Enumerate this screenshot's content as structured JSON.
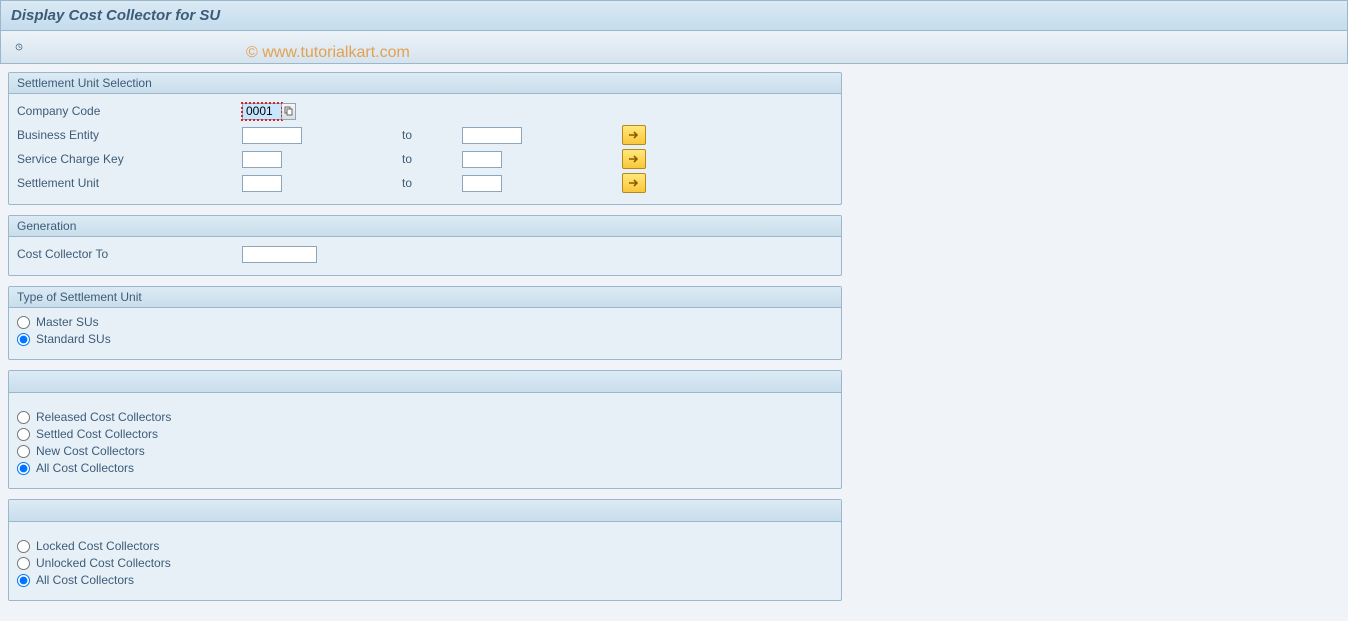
{
  "title": "Display Cost Collector for SU",
  "watermark": "© www.tutorialkart.com",
  "group1": {
    "legend": "Settlement Unit Selection",
    "company_code_label": "Company Code",
    "company_code_value": "0001",
    "business_entity_label": "Business Entity",
    "service_charge_key_label": "Service Charge Key",
    "settlement_unit_label": "Settlement Unit",
    "to_label": "to"
  },
  "group2": {
    "legend": "Generation",
    "cost_collector_to_label": "Cost Collector To"
  },
  "group3": {
    "legend": "Type of Settlement Unit",
    "opt_master": "Master SUs",
    "opt_standard": "Standard SUs"
  },
  "group4": {
    "opt_released": "Released Cost Collectors",
    "opt_settled": "Settled Cost Collectors",
    "opt_new": "New Cost Collectors",
    "opt_all": "All Cost Collectors"
  },
  "group5": {
    "opt_locked": "Locked Cost Collectors",
    "opt_unlocked": "Unlocked Cost Collectors",
    "opt_all": "All Cost Collectors"
  }
}
